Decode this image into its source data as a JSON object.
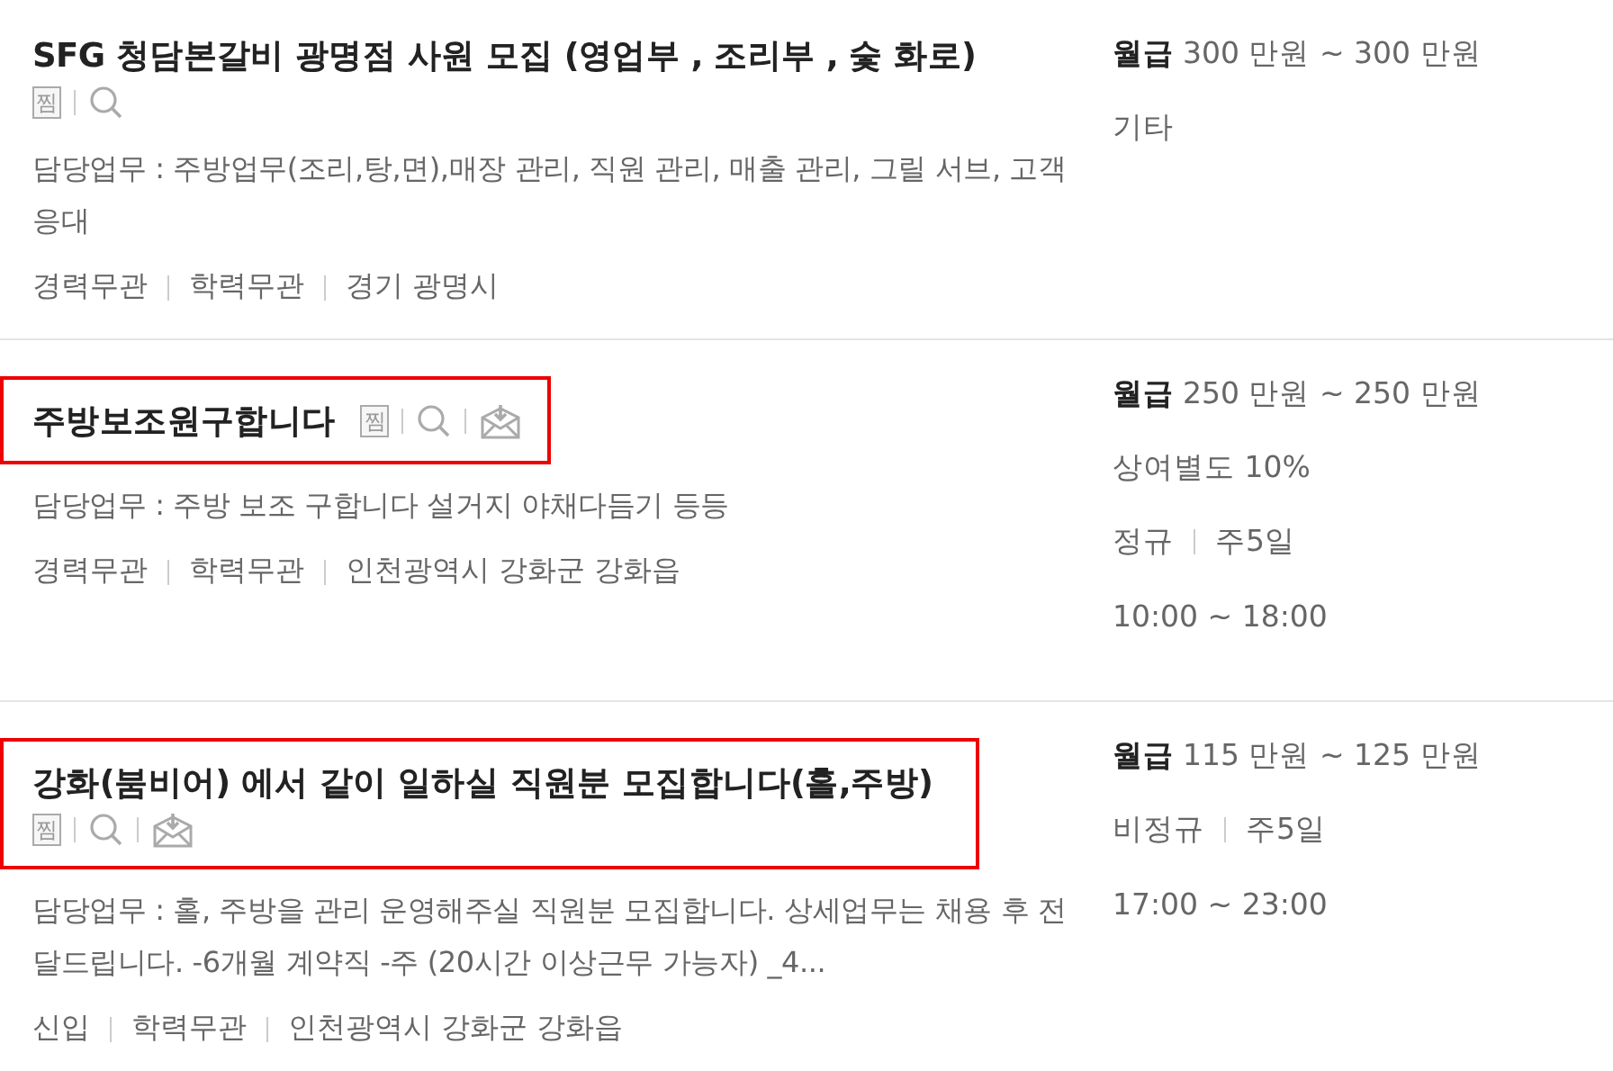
{
  "listings": [
    {
      "title": "SFG 청담본갈비 광명점 사원 모집 (영업부 , 조리부 , 숯 화로)",
      "highlighted": false,
      "bookmark": "찜",
      "email_apply": false,
      "description": "담당업무 : 주방업무(조리,탕,면),매장 관리, 직원 관리, 매출 관리, 그릴 서브, 고객 응대",
      "tags": [
        "경력무관",
        "학력무관",
        "경기 광명시"
      ],
      "salary_label": "월급",
      "salary": "300 만원 ~ 300 만원",
      "details": [
        [
          "기타"
        ]
      ]
    },
    {
      "title": "주방보조원구합니다",
      "highlighted": true,
      "bookmark": "찜",
      "email_apply": true,
      "description": "담당업무 : 주방 보조 구합니다 설거지 야채다듬기 등등",
      "tags": [
        "경력무관",
        "학력무관",
        "인천광역시 강화군 강화읍"
      ],
      "salary_label": "월급",
      "salary": "250 만원 ~ 250 만원",
      "details": [
        [
          "상여별도 10%"
        ],
        [
          "정규",
          "주5일"
        ],
        [
          "10:00 ~ 18:00"
        ]
      ]
    },
    {
      "title": "강화(붐비어) 에서 같이 일하실 직원분 모집합니다(홀,주방)",
      "highlighted": true,
      "bookmark": "찜",
      "email_apply": true,
      "description": "담당업무 : 홀, 주방을 관리 운영해주실 직원분 모집합니다. 상세업무는 채용 후 전달드립니다. -6개월 계약직 -주 (20시간 이상근무 가능자) _4...",
      "tags": [
        "신입",
        "학력무관",
        "인천광역시 강화군 강화읍"
      ],
      "salary_label": "월급",
      "salary": "115 만원 ~ 125 만원",
      "details": [
        [
          "비정규",
          "주5일"
        ],
        [
          "17:00 ~ 23:00"
        ]
      ]
    }
  ]
}
